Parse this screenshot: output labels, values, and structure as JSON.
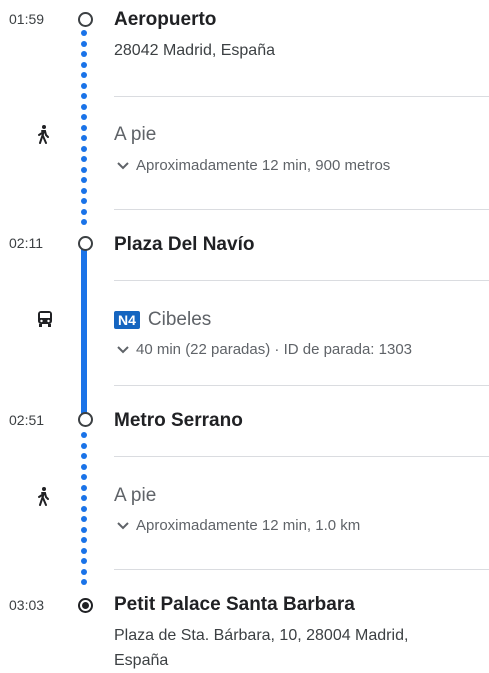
{
  "stops": [
    {
      "time": "01:59",
      "name": "Aeropuerto",
      "address": "28042 Madrid, España"
    },
    {
      "time": "02:11",
      "name": "Plaza Del Navío"
    },
    {
      "time": "02:51",
      "name": "Metro Serrano"
    },
    {
      "time": "03:03",
      "name": "Petit Palace Santa Barbara",
      "address_line1": "Plaza de Sta. Bárbara, 10, 28004 Madrid,",
      "address_line2": "España"
    }
  ],
  "legs": [
    {
      "mode": "walk",
      "icon": "walk-icon",
      "title": "A pie",
      "detail": "Aproximadamente 12 min, 900 metros"
    },
    {
      "mode": "bus",
      "icon": "bus-icon",
      "route": "N4",
      "title": "Cibeles",
      "detail": "40 min (22 paradas) · ID de parada: 1303"
    },
    {
      "mode": "walk",
      "icon": "walk-icon",
      "title": "A pie",
      "detail": "Aproximadamente 12 min, 1.0 km"
    }
  ],
  "colors": {
    "route_line": "#1a73e8",
    "route_badge": "#1565c0"
  }
}
